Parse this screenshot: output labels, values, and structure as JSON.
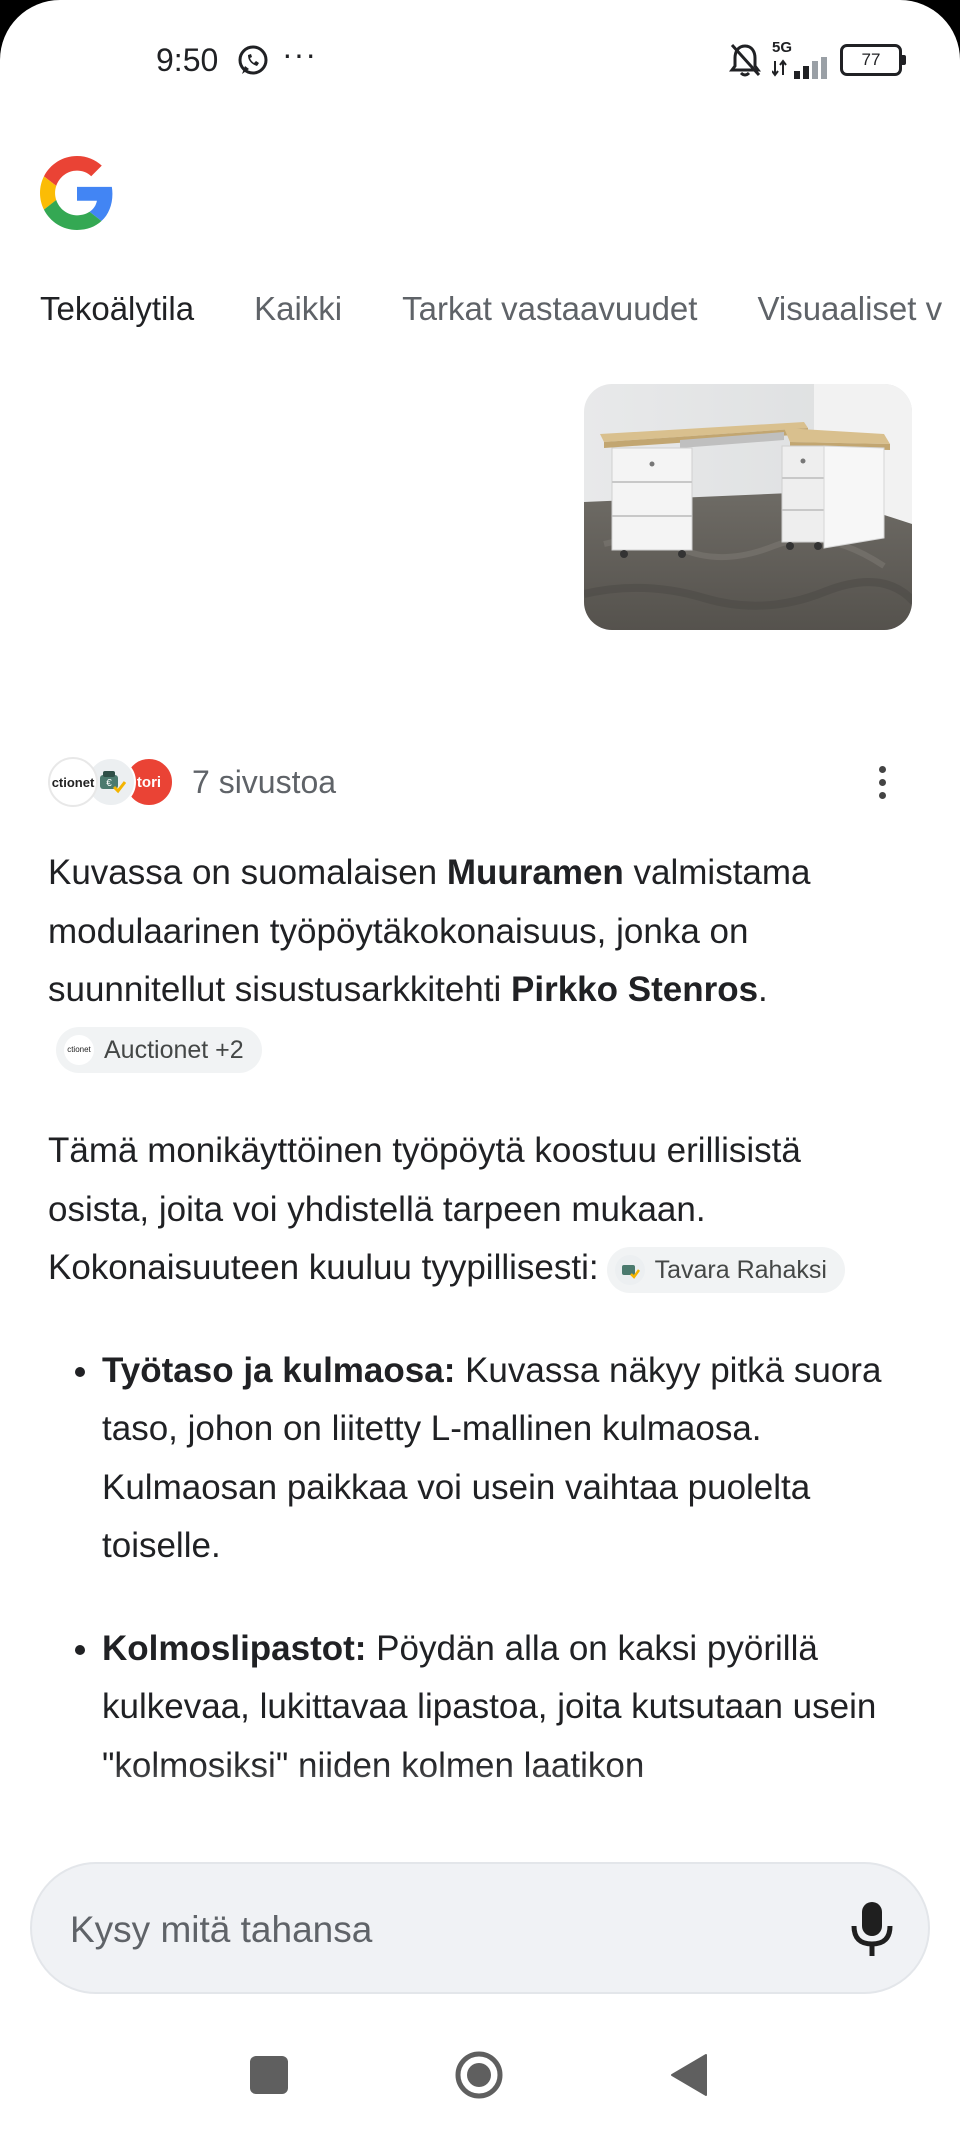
{
  "status_bar": {
    "time": "9:50",
    "dots": "···",
    "network": "5G",
    "battery": "77",
    "icons": [
      "whatsapp-icon",
      "more-dots-icon",
      "bell-off-icon",
      "signal-icon",
      "battery-icon"
    ]
  },
  "tabs": [
    {
      "label": "Tekoälytila",
      "active": true
    },
    {
      "label": "Kaikki",
      "active": false
    },
    {
      "label": "Tarkat vastaavuudet",
      "active": false
    },
    {
      "label": "Visuaaliset v",
      "active": false
    }
  ],
  "sources": {
    "favicons": [
      "ctionet",
      "€",
      "tori"
    ],
    "count_label": "7 sivustoa"
  },
  "answer": {
    "p1": {
      "t1": "Kuvassa on suomalaisen ",
      "b1": "Muuramen",
      "t2": " valmistama modulaarinen työpöytäkokonaisuus, jonka on suunnitellut sisustusarkkitehti ",
      "b2": "Pirkko Stenros",
      "t3": ".",
      "chip_icon": "ctionet",
      "chip": "Auctionet +2"
    },
    "p2": {
      "text": "Tämä monikäyttöinen työpöytä koostuu erillisistä osista, joita voi yhdistellä tarpeen mukaan. Kokonaisuuteen kuuluu tyypillisesti:",
      "chip": "Tavara Rahaksi"
    },
    "bullets": [
      {
        "title": "Työtaso ja kulmaosa:",
        "text": " Kuvassa näkyy pitkä suora taso, johon on liitetty L-mallinen kulmaosa. Kulmaosan paikkaa voi usein vaihtaa puolelta toiselle."
      },
      {
        "title": "Kolmoslipastot:",
        "text": " Pöydän alla on kaksi pyörillä kulkevaa, lukittavaa lipastoa, joita kutsutaan usein \"kolmosiksi\" niiden kolmen laatikon"
      }
    ]
  },
  "search": {
    "placeholder": "Kysy mitä tahansa"
  },
  "colors": {
    "google_blue": "#4285F4",
    "google_red": "#EA4335",
    "google_yellow": "#FBBC05",
    "google_green": "#34A853",
    "input_bg": "#f0f2f5"
  }
}
